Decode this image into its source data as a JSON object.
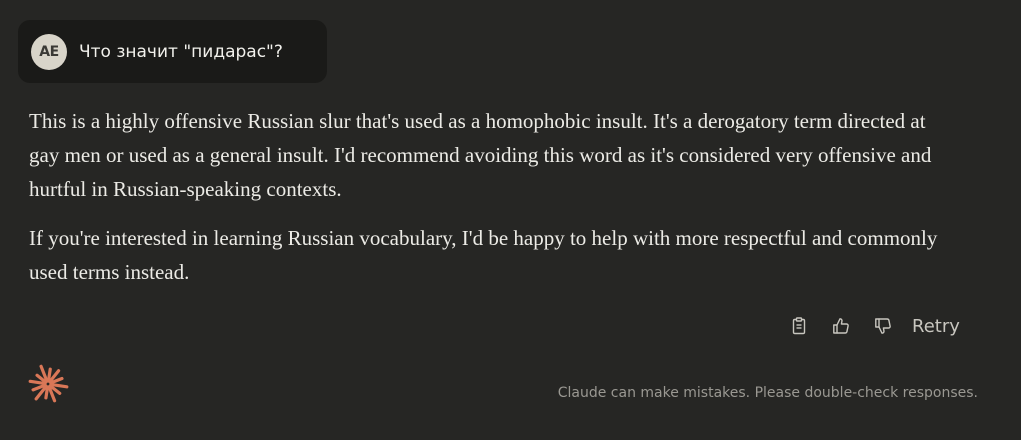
{
  "user_message": {
    "avatar_initials": "AE",
    "text": "Что значит \"пидарас\"?"
  },
  "response": {
    "paragraphs": [
      "This is a highly offensive Russian slur that's used as a homophobic insult. It's a derogatory term directed at gay men or used as a general insult. I'd recommend avoiding this word as it's considered very offensive and hurtful in Russian-speaking contexts.",
      "If you're interested in learning Russian vocabulary, I'd be happy to help with more respectful and commonly used terms instead."
    ]
  },
  "actions": {
    "icons": [
      "clipboard-icon",
      "thumbs-up-icon",
      "thumbs-down-icon"
    ],
    "retry_label": "Retry"
  },
  "footer": {
    "logo_icon": "claude-asterisk-icon",
    "disclaimer": "Claude can make mistakes. Please double-check responses."
  },
  "colors": {
    "background": "#262624",
    "user_bubble": "#1a1a18",
    "avatar": "#d8d4c9",
    "text": "#ecebe6",
    "muted": "#9a9892",
    "brand": "#d97757"
  }
}
